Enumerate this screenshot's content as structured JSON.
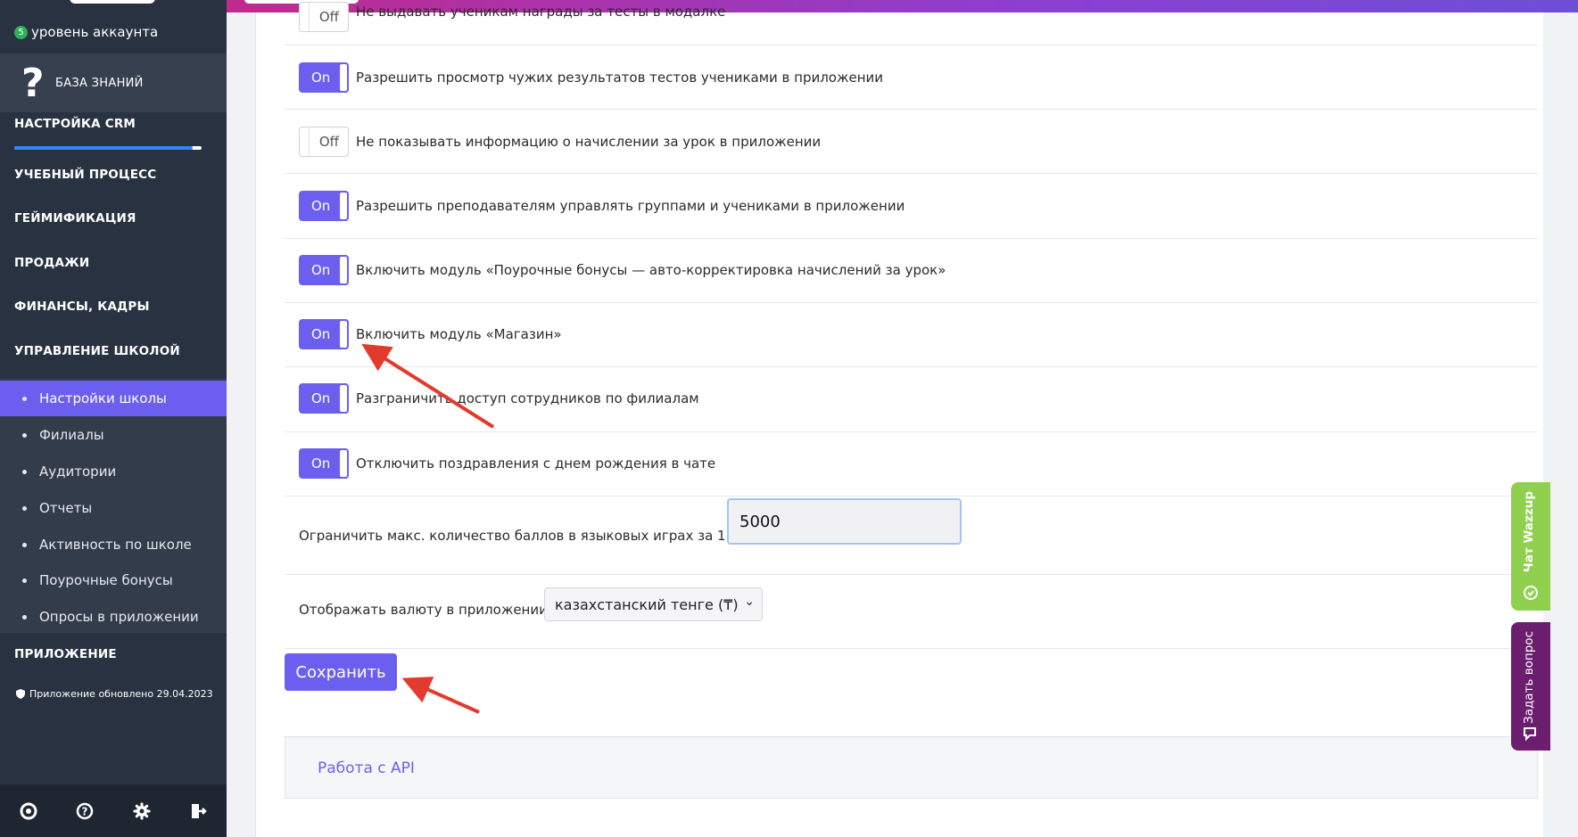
{
  "sidebar": {
    "level_badge": "5",
    "level_label": "уровень аккаунта",
    "knowledge_base": "БАЗА ЗНАНИЙ",
    "crm_setup": "НАСТРОЙКА CRM",
    "crm_progress": 0.95,
    "sections": [
      "УЧЕБНЫЙ ПРОЦЕСС",
      "ГЕЙМИФИКАЦИЯ",
      "ПРОДАЖИ",
      "ФИНАНСЫ, КАДРЫ",
      "УПРАВЛЕНИЕ ШКОЛОЙ"
    ],
    "sub_items": [
      "Настройки школы",
      "Филиалы",
      "Аудитории",
      "Отчеты",
      "Активность по школе",
      "Поурочные бонусы",
      "Опросы в приложении"
    ],
    "active_sub_item": "Настройки школы",
    "app_section": "ПРИЛОЖЕНИЕ",
    "app_updated": "Приложение обновлено 29.04.2023",
    "bottom_icons": [
      "support-icon",
      "help-icon",
      "gear-icon",
      "logout-icon"
    ]
  },
  "settings": {
    "toggles": [
      {
        "state": "Off",
        "label": "Не выдавать ученикам награды за тесты в модалке"
      },
      {
        "state": "On",
        "label": "Разрешить просмотр чужих результатов тестов учениками в приложении"
      },
      {
        "state": "Off",
        "label": "Не показывать информацию о начислении за урок в приложении"
      },
      {
        "state": "On",
        "label": "Разрешить преподавателям управлять группами и учениками в приложении"
      },
      {
        "state": "On",
        "label": "Включить модуль «Поурочные бонусы — авто-корректировка начислений за урок»"
      },
      {
        "state": "On",
        "label": "Включить модуль «Магазин»"
      },
      {
        "state": "On",
        "label": "Разграничить доступ сотрудников по филиалам"
      },
      {
        "state": "On",
        "label": "Отключить поздравления с днем рождения в чате"
      }
    ],
    "max_points_label": "Ограничить макс. количество баллов в языковых играх за 1 день",
    "max_points_value": "5000",
    "currency_label": "Отображать валюту в приложении",
    "currency_value": "казахстанский тенге (₸)",
    "save_label": "Сохранить",
    "api_link": "Работа с API"
  },
  "floating": {
    "wazzup": "Чат Wazzup",
    "ask": "Задать вопрос"
  },
  "colors": {
    "accent": "#6c5ff0",
    "sidebar_bg": "#283241",
    "wazzup": "#8fd14f",
    "ask": "#6b1e6e",
    "arrow": "#e23b2e"
  }
}
